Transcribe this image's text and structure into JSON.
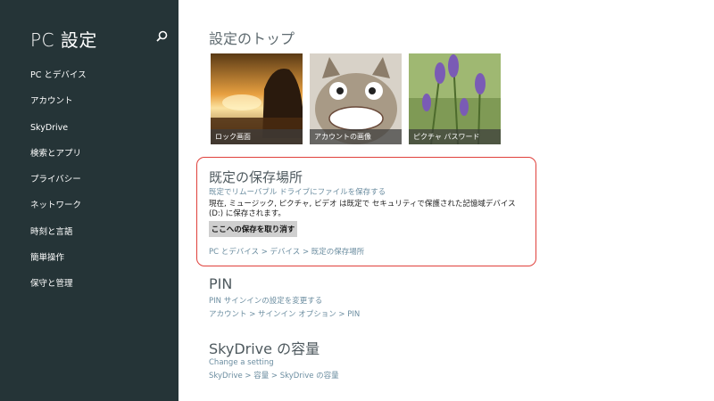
{
  "sidebar": {
    "title": "PC 設定",
    "items": [
      {
        "label": "PC とデバイス"
      },
      {
        "label": "アカウント"
      },
      {
        "label": "SkyDrive"
      },
      {
        "label": "検索とアプリ"
      },
      {
        "label": "プライバシー"
      },
      {
        "label": "ネットワーク"
      },
      {
        "label": "時刻と言語"
      },
      {
        "label": "簡単操作"
      },
      {
        "label": "保守と管理"
      }
    ]
  },
  "top": {
    "title": "設定のトップ",
    "tiles": [
      {
        "caption": "ロック画面"
      },
      {
        "caption": "アカウントの画像"
      },
      {
        "caption": "ピクチャ パスワード"
      }
    ]
  },
  "storage": {
    "title": "既定の保存場所",
    "link": "既定でリムーバブル ドライブにファイルを保存する",
    "description": "現在, ミュージック, ピクチャ, ビデオ は既定で セキュリティで保護された記憶域デバイス (D:) に保存されます。",
    "button": "ここへの保存を取り消す",
    "breadcrumb": "PC とデバイス > デバイス > 既定の保存場所"
  },
  "pin": {
    "title": "PIN",
    "link": "PIN サインインの設定を変更する",
    "breadcrumb": "アカウント > サインイン オプション > PIN"
  },
  "skydrive": {
    "title": "SkyDrive の容量",
    "link": "Change a setting",
    "breadcrumb": "SkyDrive > 容量 > SkyDrive の容量"
  },
  "colors": {
    "sidebar_bg": "#253437",
    "link": "#6b8da0",
    "highlight": "#e0403b"
  }
}
